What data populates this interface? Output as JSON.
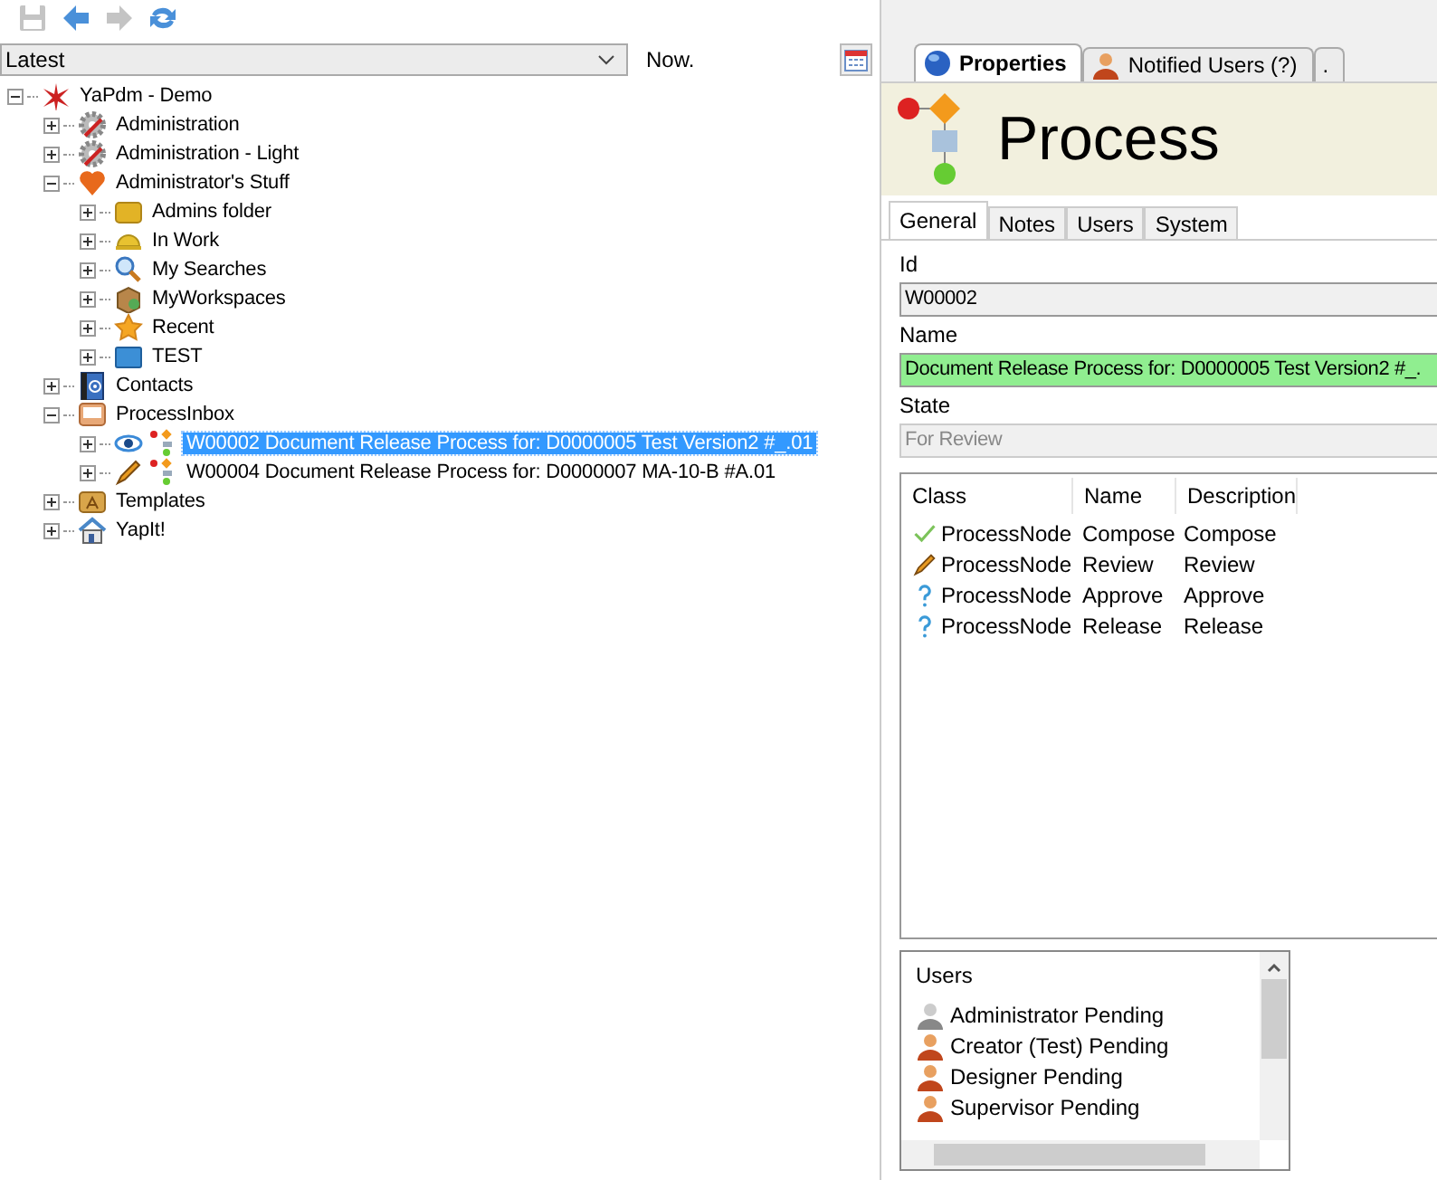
{
  "toolbar": {
    "buttons": [
      {
        "kind": "save",
        "disabled": true
      },
      {
        "kind": "back",
        "disabled": false
      },
      {
        "kind": "forward",
        "disabled": true
      },
      {
        "kind": "refresh",
        "disabled": false
      }
    ]
  },
  "version_bar": {
    "selection": "Latest",
    "date": "Now."
  },
  "tree": [
    {
      "label": "YaPdm - Demo",
      "kind": "root",
      "expanded": true,
      "selected": false,
      "children": [
        {
          "label": "Administration",
          "kind": "admin",
          "expanded": false,
          "selected": false
        },
        {
          "label": "Administration - Light",
          "kind": "admin",
          "expanded": false,
          "selected": false
        },
        {
          "label": "Administrator's Stuff",
          "kind": "favorites",
          "expanded": true,
          "selected": false,
          "children": [
            {
              "label": "Admins folder",
              "kind": "folder",
              "expanded": false,
              "selected": false
            },
            {
              "label": "In Work",
              "kind": "work",
              "expanded": false,
              "selected": false
            },
            {
              "label": "My Searches",
              "kind": "searches",
              "expanded": false,
              "selected": false
            },
            {
              "label": "MyWorkspaces",
              "kind": "workspaces",
              "expanded": false,
              "selected": false
            },
            {
              "label": "Recent",
              "kind": "recent",
              "expanded": false,
              "selected": false
            },
            {
              "label": "TEST",
              "kind": "container",
              "expanded": false,
              "selected": false
            }
          ]
        },
        {
          "label": "Contacts",
          "kind": "contacts",
          "expanded": false,
          "selected": false
        },
        {
          "label": "ProcessInbox",
          "kind": "inbox",
          "expanded": true,
          "selected": false,
          "children": [
            {
              "label": "W00002 Document Release Process for: D0000005 Test Version2  #_.01",
              "kind": "process_viewed",
              "expanded": false,
              "selected": true
            },
            {
              "label": "W00004 Document Release Process for: D0000007 MA-10-B #A.01",
              "kind": "process_editing",
              "expanded": false,
              "selected": false
            }
          ]
        },
        {
          "label": "Templates",
          "kind": "templates",
          "expanded": false,
          "selected": false
        },
        {
          "label": "YapIt!",
          "kind": "home",
          "expanded": false,
          "selected": false
        }
      ]
    }
  ],
  "tabs": [
    {
      "label": "Properties",
      "kind": "properties",
      "selected": true
    },
    {
      "label": "Notified Users (?)",
      "kind": "users",
      "selected": false
    },
    {
      "label": ".",
      "kind": "plain",
      "selected": false
    }
  ],
  "header": {
    "title": "Process"
  },
  "subtabs": [
    {
      "label": "General",
      "selected": true
    },
    {
      "label": "Notes",
      "selected": false
    },
    {
      "label": "Users",
      "selected": false
    },
    {
      "label": "System",
      "selected": false
    }
  ],
  "fields": [
    {
      "label": "Id",
      "value": "W00002",
      "kind": "plain"
    },
    {
      "label": "Name",
      "value": "Document Release Process for: D0000005 Test Version2  #_.",
      "kind": "highlight"
    },
    {
      "label": "State",
      "value": "For Review",
      "kind": "disabled"
    }
  ],
  "nodes": {
    "columns": [
      "Class",
      "Name",
      "Description"
    ],
    "rows": [
      {
        "kind": "done",
        "cells": [
          "ProcessNode",
          "Compose",
          "Compose"
        ]
      },
      {
        "kind": "active",
        "cells": [
          "ProcessNode",
          "Review",
          "Review"
        ]
      },
      {
        "kind": "pending",
        "cells": [
          "ProcessNode",
          "Approve",
          "Approve"
        ]
      },
      {
        "kind": "pending",
        "cells": [
          "ProcessNode",
          "Release",
          "Release"
        ]
      }
    ]
  },
  "users": {
    "title": "Users",
    "items": [
      {
        "label": "Administrator Pending",
        "kind": "admin"
      },
      {
        "label": "Creator (Test) Pending",
        "kind": "user"
      },
      {
        "label": "Designer Pending",
        "kind": "user"
      },
      {
        "label": "Supervisor Pending",
        "kind": "user"
      }
    ]
  }
}
